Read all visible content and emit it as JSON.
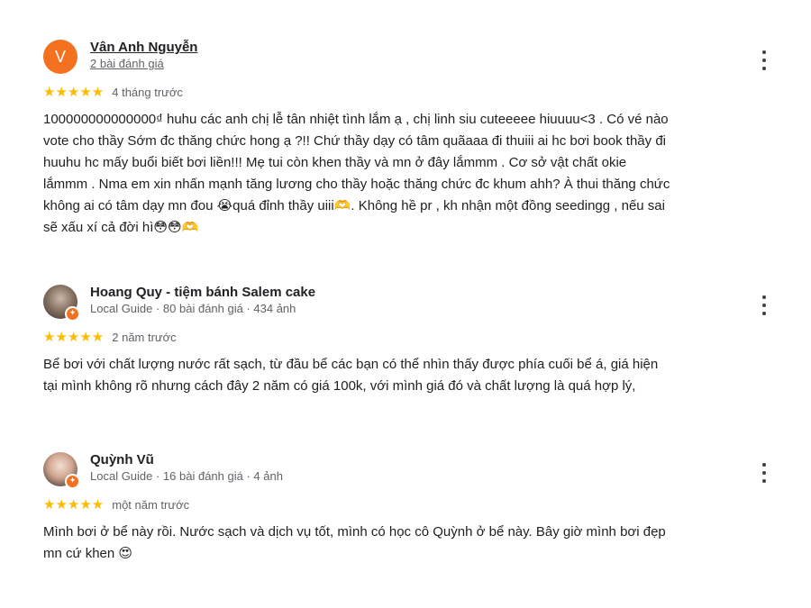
{
  "reviews": [
    {
      "avatar_letter": "V",
      "author": "Vân Anh Nguyễn",
      "author_meta": "2 bài đánh giá",
      "stars": "★★★★★",
      "rating": 5,
      "time": "4 tháng trước",
      "text": "100000000000000₫ huhu các anh chị lễ tân nhiệt tình lắm ạ , chị linh siu cuteeeee hiuuuu<3 . Có vé nào\nvote cho thầy Sớm đc thăng chức hong ạ ?!! Chứ thầy dạy có tâm quãaaa đi thuiii ai hc bơi book thầy đi\nhuuhu hc mấy buổi biết bơi liền!!! Mẹ tui còn khen thầy và mn ở đây lắmmm . Cơ sở vật chất okie\nlắmmm . Nma em xin nhấn mạnh tăng lương cho thầy hoặc thăng chức đc khum ahh? À thui thăng chức\nkhông ai có tâm dạy mn đou 😭quá đỉnh thầy uiii🫶. Không hề pr , kh nhận một đồng seedingg , nếu sai\nsẽ xấu xí cả đời hì😳😳🫶"
    },
    {
      "author": "Hoang Quy - tiệm bánh Salem cake",
      "author_meta": "Local Guide · 80 bài đánh giá · 434 ảnh",
      "stars": "★★★★★",
      "rating": 5,
      "time": "2 năm trước",
      "text": "Bể bơi với chất lượng nước rất sạch, từ đầu bể các bạn có thể nhìn thấy được phía cuối bể á, giá hiện\ntại mình không rõ nhưng cách đây 2 năm có giá 100k, với mình giá đó và chất lượng là quá hợp lý,"
    },
    {
      "author": "Quỳnh Vũ",
      "author_meta": "Local Guide · 16 bài đánh giá · 4 ảnh",
      "stars": "★★★★★",
      "rating": 5,
      "time": "một năm trước",
      "text": "Mình bơi ở bể này rồi. Nước sạch và dịch vụ tốt, mình có học cô Quỳnh ở bể này. Bây giờ mình bơi đẹp\nmn cứ khen 😍"
    }
  ],
  "colors": {
    "star": "#fbbc04",
    "avatar_letter_bg": "#f4711f",
    "text": "#202124",
    "meta": "#5f6368"
  }
}
